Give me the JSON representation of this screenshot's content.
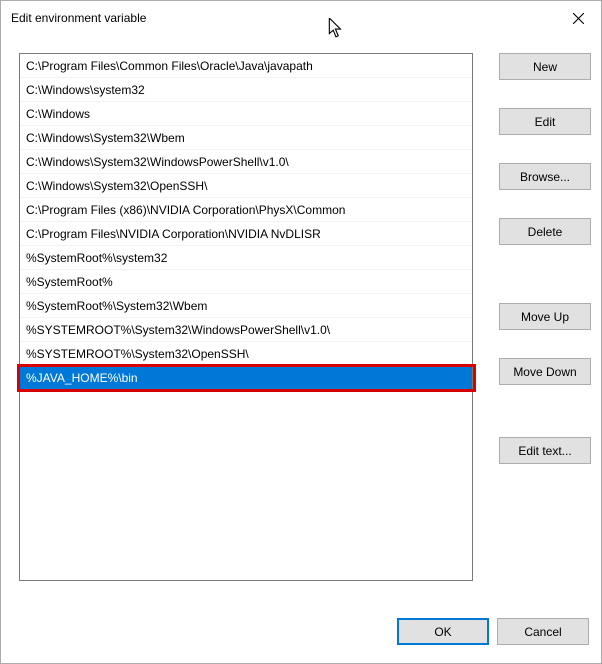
{
  "title": "Edit environment variable",
  "list": {
    "items": [
      "C:\\Program Files\\Common Files\\Oracle\\Java\\javapath",
      "C:\\Windows\\system32",
      "C:\\Windows",
      "C:\\Windows\\System32\\Wbem",
      "C:\\Windows\\System32\\WindowsPowerShell\\v1.0\\",
      "C:\\Windows\\System32\\OpenSSH\\",
      "C:\\Program Files (x86)\\NVIDIA Corporation\\PhysX\\Common",
      "C:\\Program Files\\NVIDIA Corporation\\NVIDIA NvDLISR",
      "%SystemRoot%\\system32",
      "%SystemRoot%",
      "%SystemRoot%\\System32\\Wbem",
      "%SYSTEMROOT%\\System32\\WindowsPowerShell\\v1.0\\",
      "%SYSTEMROOT%\\System32\\OpenSSH\\",
      "%JAVA_HOME%\\bin"
    ],
    "selected_index": 13
  },
  "buttons": {
    "new": "New",
    "edit": "Edit",
    "browse": "Browse...",
    "delete": "Delete",
    "move_up": "Move Up",
    "move_down": "Move Down",
    "edit_text": "Edit text...",
    "ok": "OK",
    "cancel": "Cancel"
  }
}
